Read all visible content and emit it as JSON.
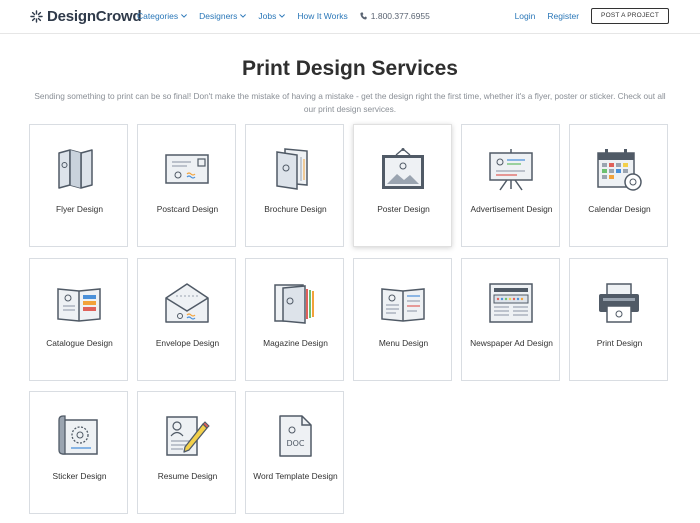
{
  "header": {
    "logo": "DesignCrowd",
    "nav": [
      "Categories",
      "Designers",
      "Jobs",
      "How It Works"
    ],
    "phone": "1.800.377.6955",
    "login": "Login",
    "register": "Register",
    "post_project": "POST A PROJECT"
  },
  "page": {
    "title": "Print Design Services",
    "intro": "Sending something to print can be so final! Don't make the mistake of having a mistake - get the design right the first time, whether it's a flyer, poster or sticker. Check out all our print design services."
  },
  "services": [
    {
      "label": "Flyer Design",
      "icon": "flyer-icon"
    },
    {
      "label": "Postcard Design",
      "icon": "postcard-icon"
    },
    {
      "label": "Brochure Design",
      "icon": "brochure-icon"
    },
    {
      "label": "Poster Design",
      "icon": "poster-icon"
    },
    {
      "label": "Advertisement Design",
      "icon": "advertisement-icon"
    },
    {
      "label": "Calendar Design",
      "icon": "calendar-icon"
    },
    {
      "label": "Catalogue Design",
      "icon": "catalogue-icon"
    },
    {
      "label": "Envelope Design",
      "icon": "envelope-icon"
    },
    {
      "label": "Magazine Design",
      "icon": "magazine-icon"
    },
    {
      "label": "Menu Design",
      "icon": "menu-icon"
    },
    {
      "label": "Newspaper Ad Design",
      "icon": "newspaper-icon"
    },
    {
      "label": "Print Design",
      "icon": "printer-icon"
    },
    {
      "label": "Sticker Design",
      "icon": "sticker-icon"
    },
    {
      "label": "Resume Design",
      "icon": "resume-icon"
    },
    {
      "label": "Word Template Design",
      "icon": "word-template-icon"
    }
  ],
  "colors": {
    "link": "#2a77b8",
    "icon_stroke": "#505a66",
    "icon_fill": "#dde3ea",
    "accent_orange": "#f2a23a",
    "accent_blue": "#4a90d9",
    "accent_green": "#6cc070",
    "accent_yellow": "#f3d04a",
    "accent_red": "#e0615a"
  }
}
